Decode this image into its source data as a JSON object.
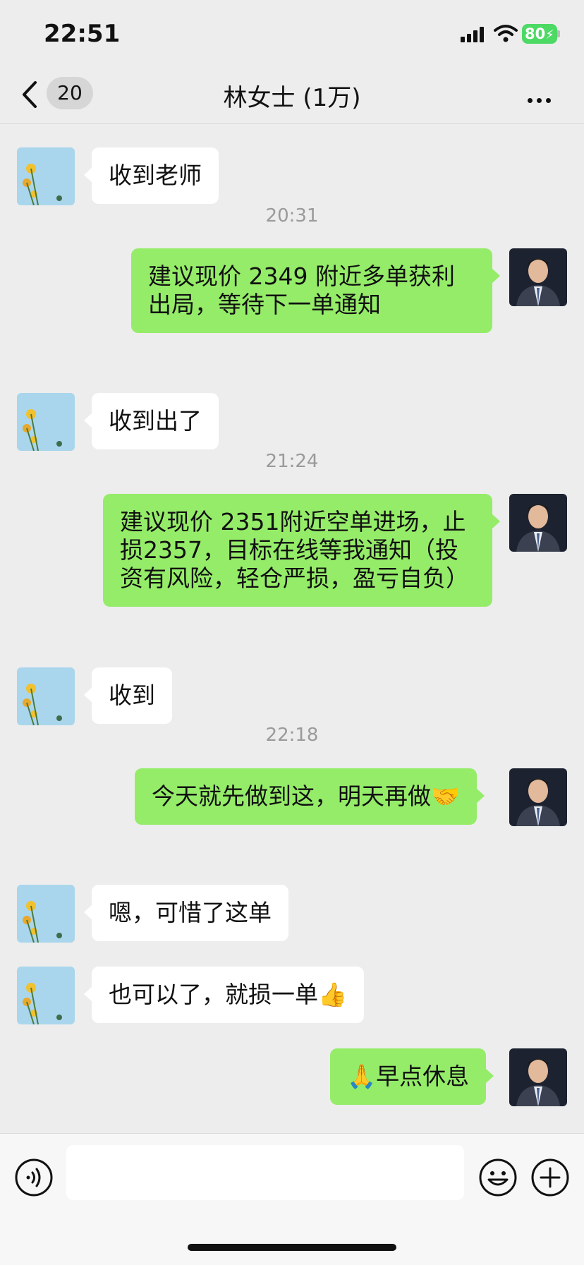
{
  "status": {
    "time": "22:51",
    "battery": "80"
  },
  "nav": {
    "badge": "20",
    "title": "林女士 (1万)"
  },
  "messages": [
    {
      "type": "in",
      "text": "收到老师",
      "avatar": "flower-avatar"
    },
    {
      "type": "time",
      "text": "20:31"
    },
    {
      "type": "out",
      "text": "建议现价 2349 附近多单获利出局，等待下一单通知",
      "avatar": "man-in-suit-avatar"
    },
    {
      "type": "in",
      "text": "收到出了",
      "avatar": "flower-avatar"
    },
    {
      "type": "time",
      "text": "21:24"
    },
    {
      "type": "out",
      "text": "建议现价 2351附近空单进场，止损2357，目标在线等我通知（投资有风险，轻仓严损，盈亏自负）",
      "avatar": "man-in-suit-avatar"
    },
    {
      "type": "in",
      "text": "收到",
      "avatar": "flower-avatar"
    },
    {
      "type": "time",
      "text": "22:18"
    },
    {
      "type": "out",
      "text": "今天就先做到这，明天再做🤝",
      "avatar": "man-in-suit-avatar"
    },
    {
      "type": "in",
      "text": "嗯，可惜了这单",
      "avatar": "flower-avatar"
    },
    {
      "type": "in",
      "text": "也可以了，就损一单👍",
      "avatar": "flower-avatar"
    },
    {
      "type": "out",
      "text": "🙏早点休息",
      "avatar": "man-in-suit-avatar"
    }
  ],
  "input": {
    "value": "",
    "placeholder": ""
  },
  "colors": {
    "incoming_bubble": "#ffffff",
    "outgoing_bubble": "#95ec69",
    "background": "#ededed",
    "battery": "#4cd964"
  }
}
